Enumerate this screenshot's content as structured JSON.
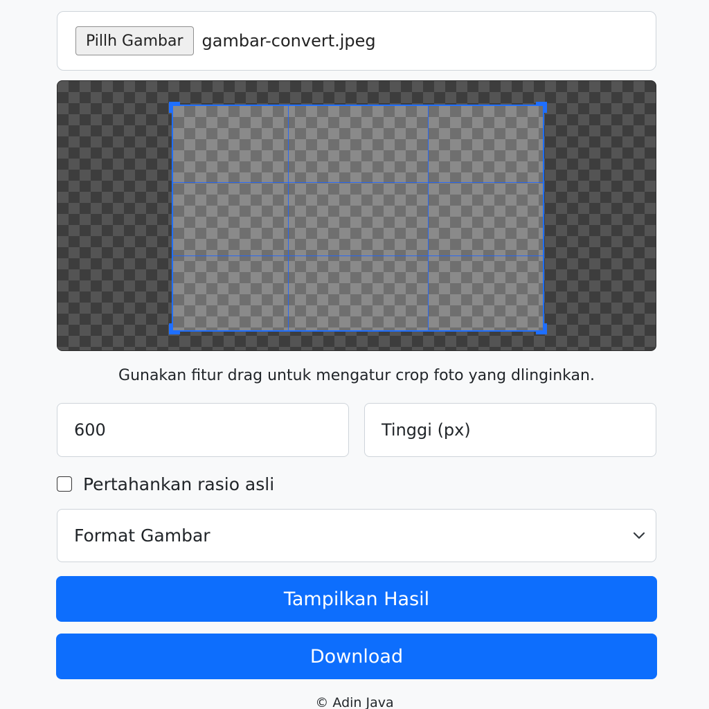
{
  "file": {
    "button_label": "Pillh Gambar",
    "file_name": "gambar-convert.jpeg"
  },
  "crop": {
    "hint": "Gunakan fitur drag untuk mengatur crop foto yang dlinginkan."
  },
  "dimensions": {
    "width_value": "600",
    "height_placeholder": "Tinggi (px)"
  },
  "ratio": {
    "label": "Pertahankan rasio asli",
    "checked": false
  },
  "format": {
    "selected": "Format Gambar"
  },
  "buttons": {
    "preview": "Tampilkan Hasil",
    "download": "Download"
  },
  "footer": {
    "text": "© Adin Java"
  },
  "colors": {
    "primary": "#0d6efd",
    "crop_accent": "#1f6fff"
  },
  "icons": {
    "select_indicator": "chevron-down-icon"
  }
}
